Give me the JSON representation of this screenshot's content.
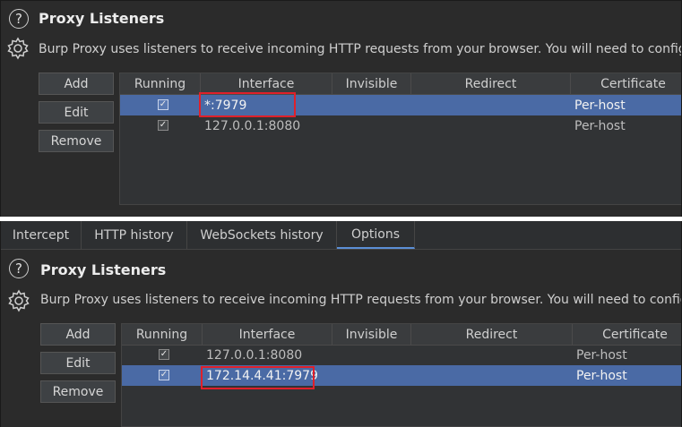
{
  "section": {
    "title": "Proxy Listeners",
    "description": "Burp Proxy uses listeners to receive incoming HTTP requests from your browser. You will need to configure your browser to use one of the listeners as its proxy server."
  },
  "buttons": {
    "add": "Add",
    "edit": "Edit",
    "remove": "Remove"
  },
  "columns": [
    "Running",
    "Interface",
    "Invisible",
    "Redirect",
    "Certificate"
  ],
  "tabs": [
    "Intercept",
    "HTTP history",
    "WebSockets history",
    "Options"
  ],
  "active_tab": "Options",
  "top_table": {
    "rows": [
      {
        "running": true,
        "interface": "*:7979",
        "invisible": "",
        "redirect": "",
        "certificate": "Per-host",
        "selected": true,
        "highlighted": true
      },
      {
        "running": true,
        "interface": "127.0.0.1:8080",
        "invisible": "",
        "redirect": "",
        "certificate": "Per-host",
        "selected": false,
        "highlighted": false
      }
    ]
  },
  "bottom_table": {
    "rows": [
      {
        "running": true,
        "interface": "127.0.0.1:8080",
        "invisible": "",
        "redirect": "",
        "certificate": "Per-host",
        "selected": false,
        "highlighted": false
      },
      {
        "running": true,
        "interface": "172.14.4.41:7979",
        "invisible": "",
        "redirect": "",
        "certificate": "Per-host",
        "selected": true,
        "highlighted": true
      }
    ]
  },
  "colors": {
    "selection": "#4a6aa5",
    "highlight_box": "#e0202a",
    "panel_bg": "#2b2b2b"
  },
  "icons": {
    "help": "question-circle-icon",
    "settings": "gear-icon",
    "check": "checkmark-icon"
  }
}
